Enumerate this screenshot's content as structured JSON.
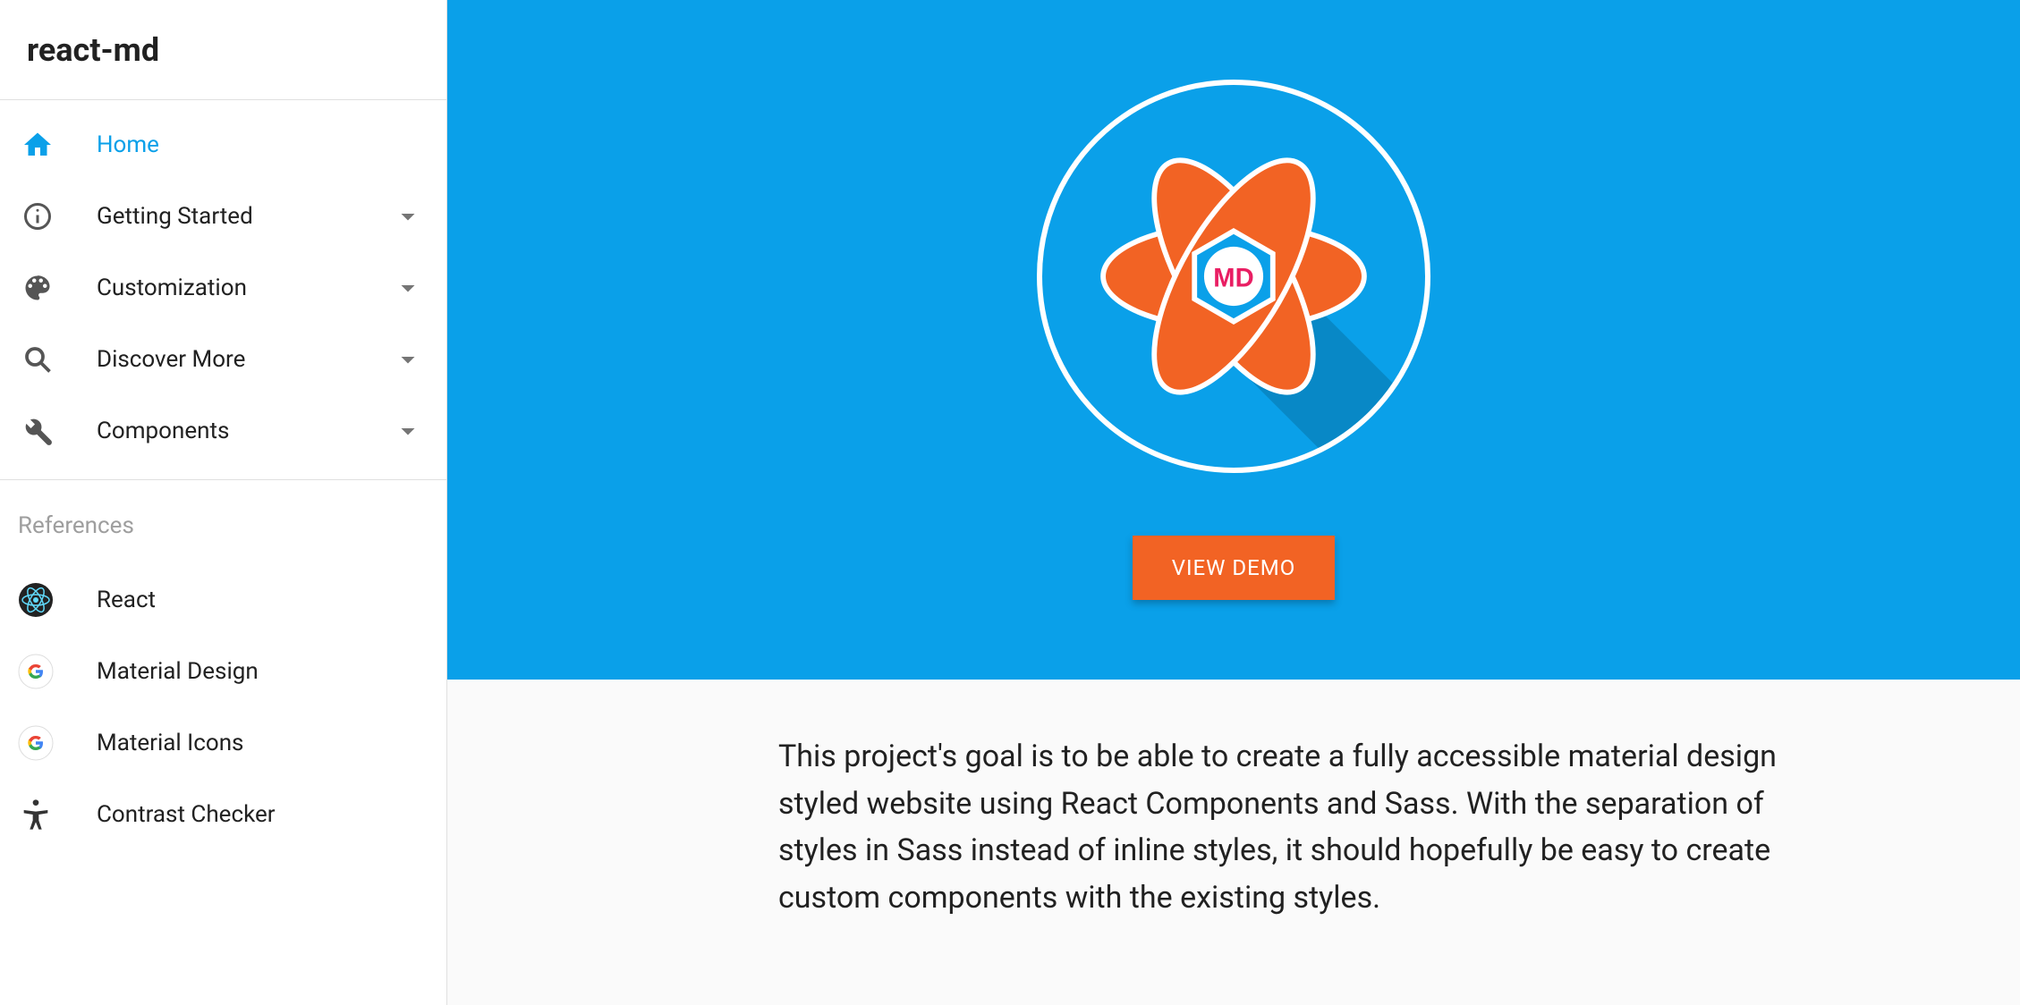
{
  "sidebar": {
    "title": "react-md",
    "nav": [
      {
        "id": "home",
        "label": "Home",
        "icon": "home-icon",
        "expandable": false,
        "active": true
      },
      {
        "id": "getting-started",
        "label": "Getting Started",
        "icon": "info-icon",
        "expandable": true,
        "active": false
      },
      {
        "id": "customization",
        "label": "Customization",
        "icon": "palette-icon",
        "expandable": true,
        "active": false
      },
      {
        "id": "discover-more",
        "label": "Discover More",
        "icon": "search-icon",
        "expandable": true,
        "active": false
      },
      {
        "id": "components",
        "label": "Components",
        "icon": "wrench-icon",
        "expandable": true,
        "active": false
      }
    ],
    "references_label": "References",
    "references": [
      {
        "id": "react",
        "label": "React",
        "icon": "react-icon"
      },
      {
        "id": "material-design",
        "label": "Material Design",
        "icon": "google-icon"
      },
      {
        "id": "material-icons",
        "label": "Material Icons",
        "icon": "google-icon"
      },
      {
        "id": "contrast-checker",
        "label": "Contrast Checker",
        "icon": "accessibility-icon"
      }
    ]
  },
  "hero": {
    "logo_badge_text": "MD",
    "demo_button_label": "VIEW DEMO"
  },
  "intro": {
    "text": "This project's goal is to be able to create a fully accessible material design styled website using React Components and Sass. With the separation of styles in Sass instead of inline styles, it should hopefully be easy to create custom components with the existing styles."
  },
  "colors": {
    "accent_blue": "#0aa0e9",
    "accent_orange": "#f26324"
  }
}
